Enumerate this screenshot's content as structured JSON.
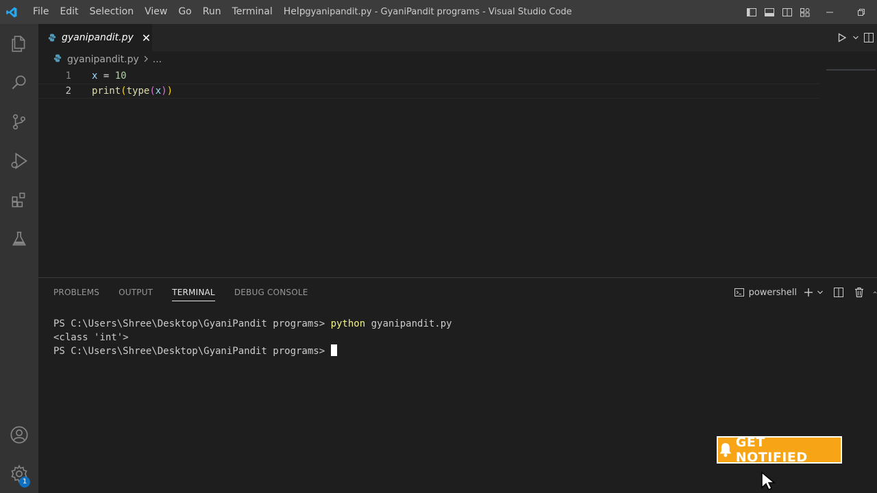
{
  "titlebar": {
    "menu": [
      "File",
      "Edit",
      "Selection",
      "View",
      "Go",
      "Run",
      "Terminal",
      "Help"
    ],
    "window_title": "gyanipandit.py - GyaniPandit programs - Visual Studio Code"
  },
  "tab": {
    "label": "gyanipandit.py",
    "close": "✕"
  },
  "breadcrumb": {
    "file": "gyanipandit.py",
    "rest": "..."
  },
  "editor": {
    "lines": [
      {
        "number": "1",
        "tokens": [
          "x",
          " = ",
          "10"
        ]
      },
      {
        "number": "2",
        "tokens": [
          "print",
          "(",
          "type",
          "(",
          "x",
          ")",
          ")"
        ]
      }
    ]
  },
  "panel": {
    "tabs": [
      "PROBLEMS",
      "OUTPUT",
      "TERMINAL",
      "DEBUG CONSOLE"
    ],
    "active_tab": "TERMINAL",
    "shell": "powershell"
  },
  "terminal": {
    "prompt1": "PS C:\\Users\\Shree\\Desktop\\GyaniPandit programs> ",
    "command_name": "python",
    "command_args": " gyanipandit.py",
    "output": "<class 'int'>",
    "prompt2": "PS C:\\Users\\Shree\\Desktop\\GyaniPandit programs> "
  },
  "accounts": {
    "settings_badge": "1"
  },
  "overlay": {
    "notify_label": "GET NOTIFIED"
  },
  "colors": {
    "accent": "#0e70c0",
    "notify": "#f7a416",
    "titlebar": "#3c3c3c",
    "activitybar": "#333333"
  }
}
